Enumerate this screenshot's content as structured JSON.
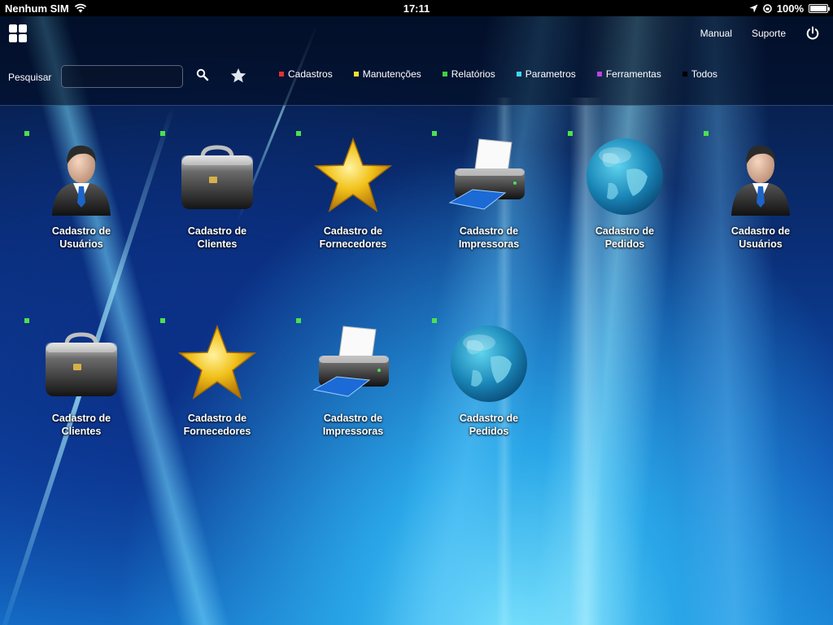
{
  "status_bar": {
    "carrier": "Nenhum SIM",
    "time": "17:11",
    "battery": "100%",
    "battery_level": 1.0
  },
  "top_nav": {
    "links": [
      "Manual",
      "Suporte"
    ],
    "icons": [
      "apps-grid-icon",
      "power-icon"
    ]
  },
  "search": {
    "label": "Pesquisar",
    "value": "",
    "placeholder": ""
  },
  "filters": [
    {
      "label": "Cadastros",
      "color": "#e53030"
    },
    {
      "label": "Manutenções",
      "color": "#f0e030"
    },
    {
      "label": "Relatórios",
      "color": "#40d040"
    },
    {
      "label": "Parametros",
      "color": "#40d8f0"
    },
    {
      "label": "Ferramentas",
      "color": "#c040e0"
    },
    {
      "label": "Todos",
      "color": "#000000"
    }
  ],
  "tiles": [
    {
      "line1": "Cadastro de",
      "line2": "Usuários",
      "icon": "user-icon"
    },
    {
      "line1": "Cadastro de",
      "line2": "Clientes",
      "icon": "briefcase-icon"
    },
    {
      "line1": "Cadastro de",
      "line2": "Fornecedores",
      "icon": "star-icon"
    },
    {
      "line1": "Cadastro de",
      "line2": "Impressoras",
      "icon": "printer-icon"
    },
    {
      "line1": "Cadastro de",
      "line2": "Pedidos",
      "icon": "globe-icon"
    },
    {
      "line1": "Cadastro de",
      "line2": "Usuários",
      "icon": "user-icon"
    },
    {
      "line1": "Cadastro de",
      "line2": "Clientes",
      "icon": "briefcase-icon"
    },
    {
      "line1": "Cadastro de",
      "line2": "Fornecedores",
      "icon": "star-icon"
    },
    {
      "line1": "Cadastro de",
      "line2": "Impressoras",
      "icon": "printer-icon"
    },
    {
      "line1": "Cadastro de",
      "line2": "Pedidos",
      "icon": "globe-icon"
    }
  ],
  "colors": {
    "indicator": "#4de04d",
    "background_dark": "#061634",
    "background_light": "#7fe6ff"
  }
}
